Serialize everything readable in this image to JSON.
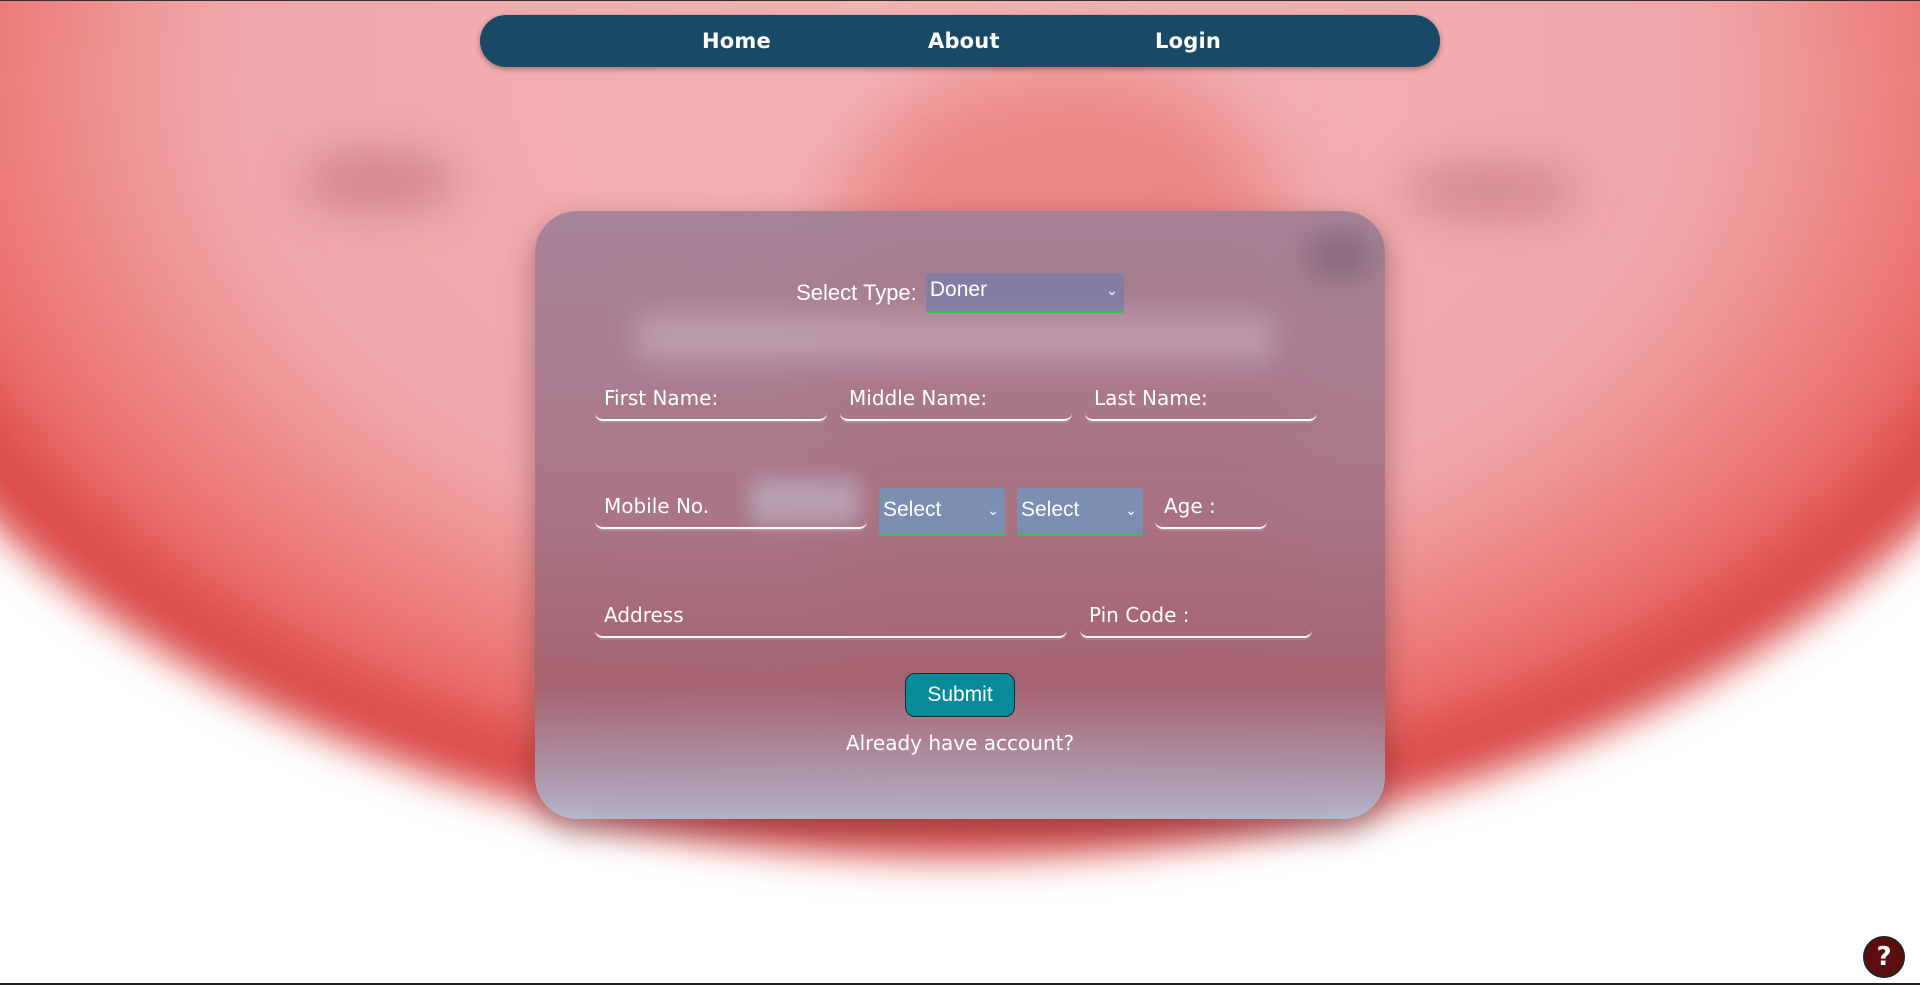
{
  "nav": {
    "home": "Home",
    "about": "About",
    "login": "Login"
  },
  "form": {
    "type_label": "Select Type:",
    "type_value": "Doner",
    "first_name": "First Name:",
    "middle_name": "Middle Name:",
    "last_name": "Last Name:",
    "mobile": "Mobile No.",
    "select_a": "Select",
    "select_b": "Select",
    "age": "Age :",
    "address": "Address",
    "pin_code": "Pin Code :",
    "submit": "Submit",
    "account_link": "Already have account?"
  },
  "help": {
    "label": "?"
  },
  "colors": {
    "navbar": "#184a66",
    "submit": "#078a9a",
    "select_border": "#3cc23c",
    "help_button": "#5c0d0d"
  },
  "icons": {
    "select_chevron": "chevron-down-icon",
    "help": "question-icon"
  }
}
